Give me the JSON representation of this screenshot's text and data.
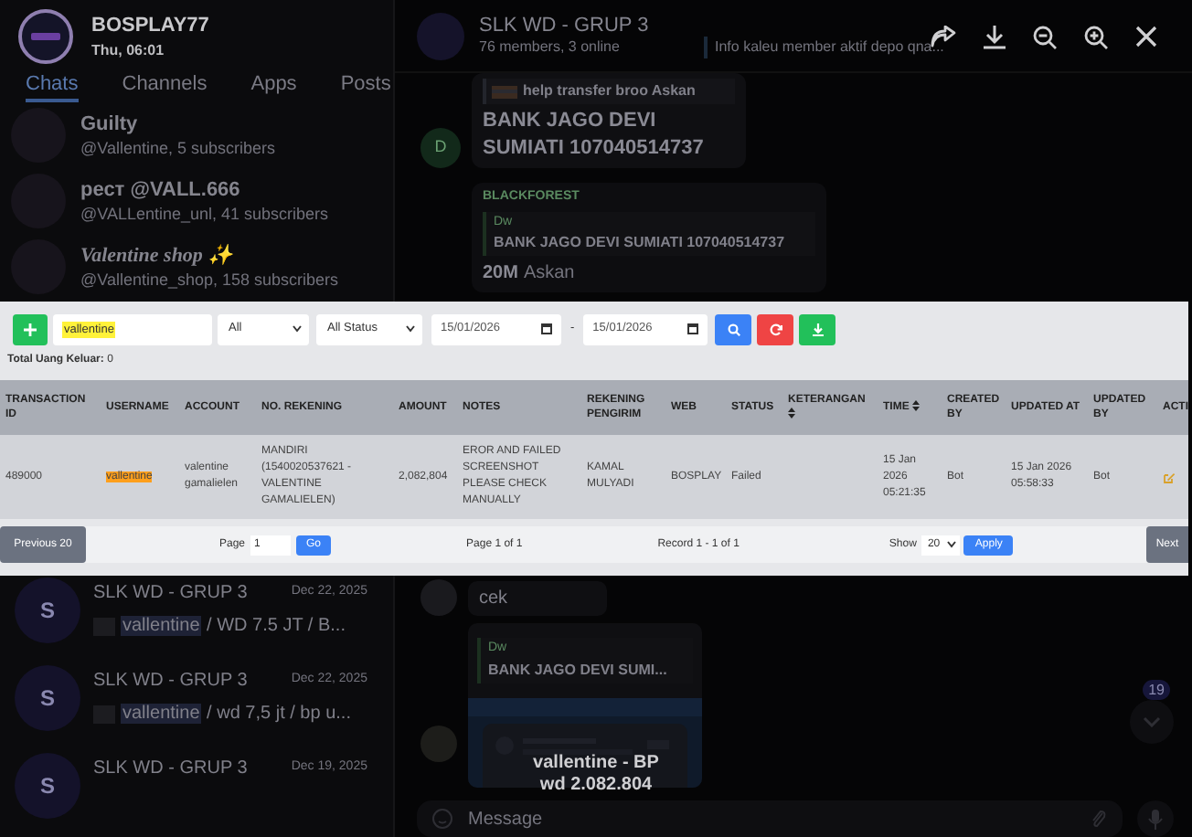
{
  "viewer": {
    "sender": "BOSPLAY77",
    "time": "Thu, 06:01",
    "caption": "vallentine - BP",
    "caption_extra": "wd 2.082.804"
  },
  "chat_tabs": [
    {
      "label": "Chats",
      "selected": true
    },
    {
      "label": "Channels",
      "selected": false
    },
    {
      "label": "Apps",
      "selected": false
    },
    {
      "label": "Posts",
      "selected": false
    }
  ],
  "chat_list_top": [
    {
      "title": "Guilty",
      "subtitle": "@Vallentine, 5 subscribers",
      "italic": false
    },
    {
      "title": "рест @VALL.666",
      "subtitle": "@VALLentine_unl, 41 subscribers",
      "italic": false
    },
    {
      "title": "Valentine shop ✨",
      "subtitle": "@Vallentine_shop, 158 subscribers",
      "italic": true
    }
  ],
  "chat_list_bottom": [
    {
      "avatar": "S",
      "title": "SLK WD - GRUP 3",
      "date": "Dec 22, 2025",
      "match": "vallentine",
      "preview": " / WD 7.5 JT / B..."
    },
    {
      "avatar": "S",
      "title": "SLK WD - GRUP 3",
      "date": "Dec 22, 2025",
      "match": "vallentine",
      "preview": " / wd 7,5 jt / bp u..."
    },
    {
      "avatar": "S",
      "title": "SLK WD - GRUP 3",
      "date": "Dec 19, 2025"
    }
  ],
  "chat_header": {
    "title": "SLK WD - GRUP 3",
    "status": "76 members, 3 online",
    "pinned": "Info kaleu member aktif depo qna..."
  },
  "message_1": {
    "avatar": "D",
    "quote": "help transfer broo Askan",
    "text": "BANK JAGO DEVI SUMIATI 107040514737"
  },
  "message_2": {
    "sender": "BLACKFOREST",
    "quote_author": "Dw",
    "quote": "BANK JAGO DEVI SUMIATI 107040514737",
    "amount": "20M",
    "author": "Askan"
  },
  "message_3": {
    "text": "cek"
  },
  "message_4": {
    "quote_author": "Dw",
    "quote": "BANK JAGO DEVI SUMI..."
  },
  "unread_badge": "19",
  "composer": {
    "placeholder": "Message"
  },
  "report": {
    "search": "vallentine",
    "filter_1": "All",
    "filter_2": "All Status",
    "date_from": "15/01/2026",
    "separator": "-",
    "date_to": "15/01/2026",
    "total": "**Total Uang Keluar:** 0",
    "columns": [
      {
        "label": "TRANSACTION ID",
        "sortable": false
      },
      {
        "label": "USERNAME",
        "sortable": false
      },
      {
        "label": "ACCOUNT",
        "sortable": false
      },
      {
        "label": "NO. REKENING",
        "sortable": false
      },
      {
        "label": "AMOUNT",
        "sortable": false
      },
      {
        "label": "NOTES",
        "sortable": false
      },
      {
        "label": "REKENING PENGIRIM",
        "sortable": false
      },
      {
        "label": "WEB",
        "sortable": false
      },
      {
        "label": "STATUS",
        "sortable": false
      },
      {
        "label": "KETERANGAN",
        "sortable": true
      },
      {
        "label": "TIME",
        "sortable": true
      },
      {
        "label": "CREATED BY",
        "sortable": false
      },
      {
        "label": "UPDATED AT",
        "sortable": false
      },
      {
        "label": "UPDATED BY",
        "sortable": false
      },
      {
        "label": "ACTI",
        "sortable": false
      }
    ],
    "rows": [
      {
        "cells": [
          {
            "text": "489000",
            "highlight": false
          },
          {
            "text": "vallentine",
            "highlight": true
          },
          {
            "text": "valentine gamalielen",
            "highlight": false
          },
          {
            "text": "MANDIRI (1540020537621 - VALENTINE GAMALIELEN)",
            "highlight": false
          },
          {
            "text": "2,082,804",
            "highlight": false
          },
          {
            "text": "EROR AND FAILED SCREENSHOT PLEASE CHECK MANUALLY",
            "highlight": false
          },
          {
            "text": "KAMAL MULYADI",
            "highlight": false
          },
          {
            "text": "BOSPLAY",
            "highlight": false
          },
          {
            "text": "Failed",
            "highlight": false
          },
          {},
          {
            "text": "15 Jan 2026 05:21:35",
            "highlight": false
          },
          {
            "text": "Bot",
            "highlight": false
          },
          {
            "text": "15 Jan 2026 05:58:33",
            "highlight": false
          },
          {
            "text": "Bot",
            "highlight": false
          }
        ]
      }
    ],
    "pagination": {
      "previous": "Previous 20",
      "page_label": "Page",
      "page_value": "1",
      "go": "Go",
      "page_info": "Page 1 of 1",
      "record_info": "Record 1 - 1 of 1",
      "show_label": "Show",
      "show_value": "20",
      "apply": "Apply",
      "next": "Next"
    }
  }
}
